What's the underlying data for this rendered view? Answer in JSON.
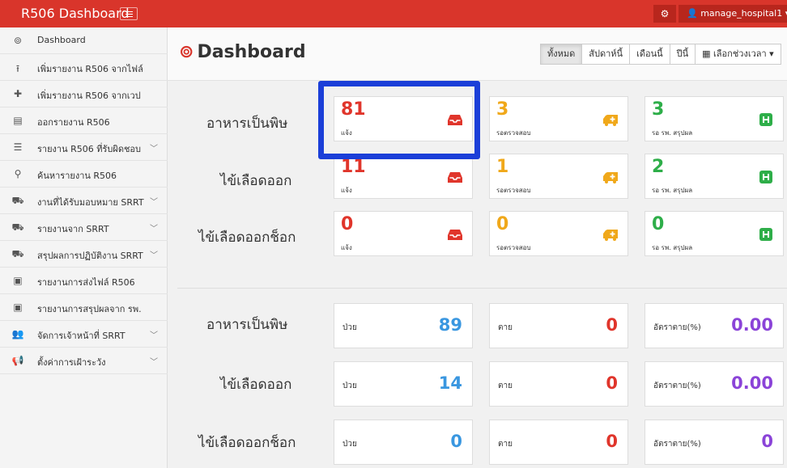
{
  "app": {
    "brand": "R506 Dashboard"
  },
  "topbar": {
    "user_label": "manage_hospital1 ▾"
  },
  "sidebar": {
    "items": [
      {
        "label": "Dashboard",
        "icon": "dashboard-icon",
        "glyph": "⊚",
        "chevron": false
      },
      {
        "label": "เพิ่มรายงาน R506 จากไฟล์",
        "icon": "upload-icon",
        "glyph": "⭱",
        "chevron": false
      },
      {
        "label": "เพิ่มรายงาน R506 จากเวป",
        "icon": "plus-icon",
        "glyph": "✚",
        "chevron": false
      },
      {
        "label": "ออกรายงาน R506",
        "icon": "file-icon",
        "glyph": "▤",
        "chevron": false
      },
      {
        "label": "รายงาน R506 ที่รับผิดชอบ",
        "icon": "list-icon",
        "glyph": "☰",
        "chevron": true
      },
      {
        "label": "ค้นหารายงาน R506",
        "icon": "search-icon",
        "glyph": "⚲",
        "chevron": false
      },
      {
        "label": "งานที่ได้รับมอบหมาย SRRT",
        "icon": "ambulance-icon",
        "glyph": "⛟",
        "chevron": true
      },
      {
        "label": "รายงานจาก SRRT",
        "icon": "ambulance-icon",
        "glyph": "⛟",
        "chevron": true
      },
      {
        "label": "สรุปผลการปฏิบัติงาน SRRT",
        "icon": "ambulance-icon",
        "glyph": "⛟",
        "chevron": true
      },
      {
        "label": "รายงานการส่งไฟล์ R506",
        "icon": "clipboard-icon",
        "glyph": "▣",
        "chevron": false
      },
      {
        "label": "รายงานการสรุปผลจาก รพ.",
        "icon": "clipboard-icon",
        "glyph": "▣",
        "chevron": false
      },
      {
        "label": "จัดการเจ้าหน้าที่ SRRT",
        "icon": "users-icon",
        "glyph": "👥",
        "chevron": true
      },
      {
        "label": "ตั้งค่าการเฝ้าระวัง",
        "icon": "bullhorn-icon",
        "glyph": "📢",
        "chevron": true
      }
    ]
  },
  "main": {
    "title": "Dashboard",
    "filters": [
      "ทั้งหมด",
      "สัปดาห์นี้",
      "เดือนนี้",
      "ปีนี้",
      "เลือกช่วงเวลา ▾"
    ],
    "status_rows": [
      {
        "label": "อาหารเป็นพิษ",
        "notified": "81",
        "notified_label": "แจ้ง",
        "investigating": "3",
        "investigating_label": "รอตรวจสอบ",
        "hospital": "3",
        "hospital_label": "รอ รพ. สรุปผล"
      },
      {
        "label": "ไข้เลือดออก",
        "notified": "11",
        "notified_label": "แจ้ง",
        "investigating": "1",
        "investigating_label": "รอตรวจสอบ",
        "hospital": "2",
        "hospital_label": "รอ รพ. สรุปผล"
      },
      {
        "label": "ไข้เลือดออกช็อก",
        "notified": "0",
        "notified_label": "แจ้ง",
        "investigating": "0",
        "investigating_label": "รอตรวจสอบ",
        "hospital": "0",
        "hospital_label": "รอ รพ. สรุปผล"
      }
    ],
    "stat_rows": [
      {
        "label": "อาหารเป็นพิษ",
        "sick_label": "ป่วย",
        "sick": "89",
        "dead_label": "ตาย",
        "dead": "0",
        "rate_label": "อัตราตาย(%)",
        "rate": "0.00"
      },
      {
        "label": "ไข้เลือดออก",
        "sick_label": "ป่วย",
        "sick": "14",
        "dead_label": "ตาย",
        "dead": "0",
        "rate_label": "อัตราตาย(%)",
        "rate": "0.00"
      },
      {
        "label": "ไข้เลือดออกช็อก",
        "sick_label": "ป่วย",
        "sick": "0",
        "dead_label": "ตาย",
        "dead": "0",
        "rate_label": "อัตราตาย(%)",
        "rate": "0"
      }
    ]
  },
  "colors": {
    "topbar": "#d9352b",
    "red": "#e0352b",
    "orange": "#f0a81a",
    "green": "#2eae49",
    "blue": "#3a97e0",
    "purple": "#8b44d8",
    "highlight": "#1b3fd8"
  }
}
